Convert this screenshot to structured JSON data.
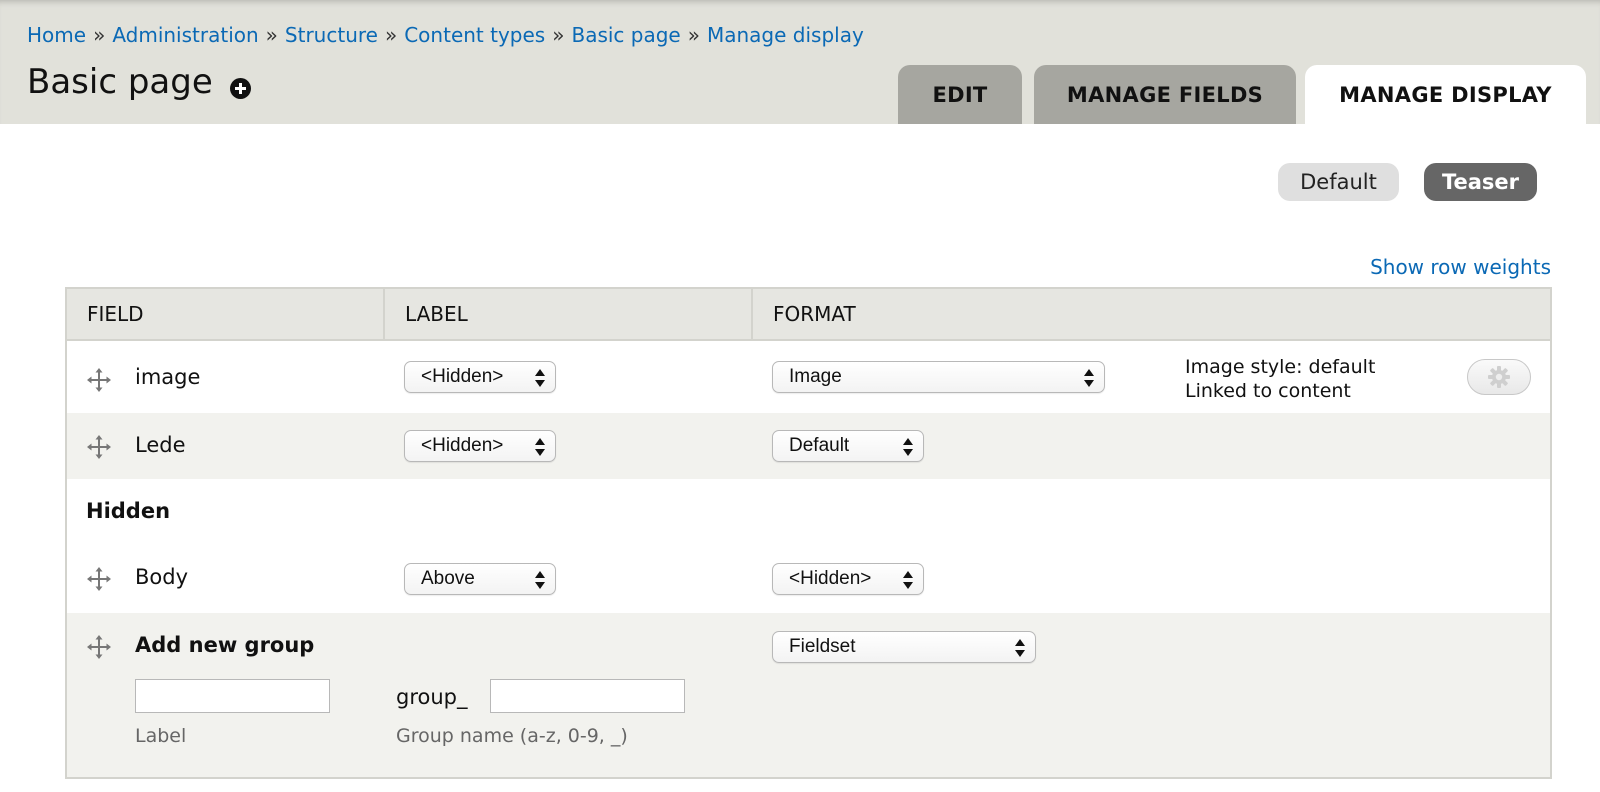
{
  "breadcrumb": [
    "Home",
    "Administration",
    "Structure",
    "Content types",
    "Basic page",
    "Manage display"
  ],
  "breadcrumb_separator": "»",
  "page_title": "Basic page",
  "tabs": [
    {
      "label": "EDIT",
      "active": false
    },
    {
      "label": "MANAGE FIELDS",
      "active": false
    },
    {
      "label": "MANAGE DISPLAY",
      "active": true
    }
  ],
  "view_modes": [
    {
      "label": "Default",
      "active": false
    },
    {
      "label": "Teaser",
      "active": true
    }
  ],
  "show_row_weights": "Show row weights",
  "table": {
    "headers": [
      "FIELD",
      "LABEL",
      "FORMAT"
    ],
    "rows": [
      {
        "name": "image",
        "label": "<Hidden>",
        "format": "Image",
        "summary": [
          "Image style: default",
          "Linked to content"
        ],
        "icon": "gear-icon"
      },
      {
        "name": "Lede",
        "label": "<Hidden>",
        "format": "Default"
      }
    ],
    "hidden_section": "Hidden",
    "hidden_rows": [
      {
        "name": "Body",
        "label": "Above",
        "format": "<Hidden>"
      }
    ],
    "add_group": {
      "name": "Add new group",
      "format": "Fieldset",
      "label_value": "",
      "label_hint": "Label",
      "group_prefix": "group_",
      "group_name_value": "",
      "group_name_hint": "Group name (a-z, 0-9, _)"
    }
  },
  "colors": {
    "link": "#0b69b5",
    "header_bg": "#e1e1da",
    "tab_inactive": "#a6a6a0",
    "teaser_bg": "#666666",
    "row_alt": "#f2f2ee"
  }
}
